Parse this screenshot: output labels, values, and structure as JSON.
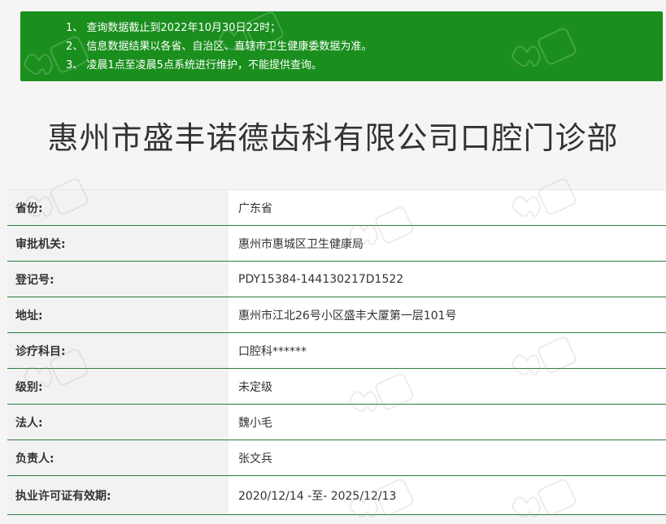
{
  "notice": {
    "lines": [
      "1、 查询数据截止到2022年10月30日22时；",
      "2、 信息数据结果以各省、自治区、直辖市卫生健康委数据为准。",
      "3、 凌晨1点至凌晨5点系统进行维护，不能提供查询。"
    ],
    "background_color": "#1a8f1e"
  },
  "title": "惠州市盛丰诺德齿科有限公司口腔门诊部",
  "table": {
    "rows": [
      {
        "label": "省份:",
        "value": "广东省"
      },
      {
        "label": "审批机关:",
        "value": "惠州市惠城区卫生健康局"
      },
      {
        "label": "登记号:",
        "value": "PDY15384-144130217D1522"
      },
      {
        "label": "地址:",
        "value": "惠州市江北26号小区盛丰大厦第一层101号"
      },
      {
        "label": "诊疗科目:",
        "value": "口腔科******"
      },
      {
        "label": "级别:",
        "value": "未定级"
      },
      {
        "label": "法人:",
        "value": "魏小毛"
      },
      {
        "label": "负责人:",
        "value": "张文兵"
      },
      {
        "label": "执业许可证有效期:",
        "value": "2020/12/14 -至- 2025/12/13"
      }
    ],
    "divider_color": "#2f7d3b"
  },
  "watermark": {
    "text": "齐乐韩口腔",
    "icon": "tooth-logo-icon"
  }
}
